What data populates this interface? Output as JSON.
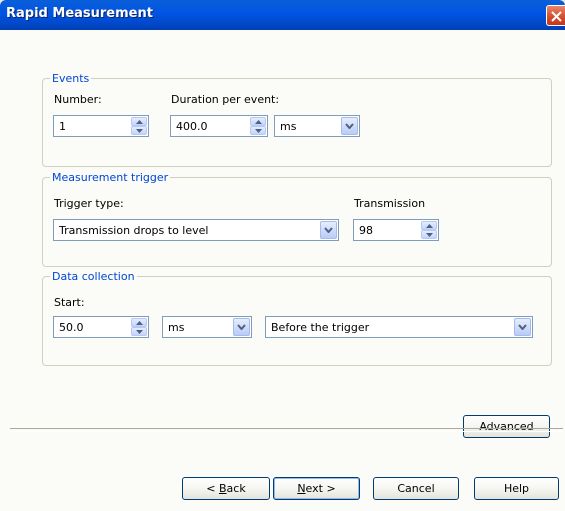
{
  "window": {
    "title": "Rapid Measurement"
  },
  "events": {
    "legend": "Events",
    "number_label": "Number:",
    "number_value": "1",
    "duration_label": "Duration per event:",
    "duration_value": "400.0",
    "duration_unit": "ms"
  },
  "trigger": {
    "legend": "Measurement trigger",
    "type_label": "Trigger type:",
    "type_value": "Transmission drops to level",
    "transmission_label": "Transmission",
    "transmission_value": "98"
  },
  "collection": {
    "legend": "Data collection",
    "start_label": "Start:",
    "start_value": "50.0",
    "start_unit": "ms",
    "relative": "Before the trigger"
  },
  "buttons": {
    "advanced": "Advanced",
    "back_pre": "< ",
    "back_mn": "B",
    "back_post": "ack",
    "next_mn": "N",
    "next_post": "ext >",
    "cancel": "Cancel",
    "help": "Help"
  },
  "colors": {
    "titlebar": "#0054e3",
    "legend": "#0046d5",
    "close": "#d4502f"
  }
}
